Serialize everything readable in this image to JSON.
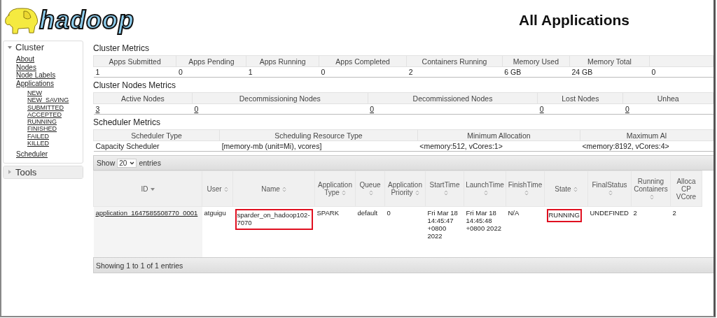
{
  "header": {
    "logo_text": "hadoop",
    "title": "All Applications"
  },
  "sidebar": {
    "sections": [
      {
        "label": "Cluster",
        "expanded": true,
        "items": [
          {
            "label": "About"
          },
          {
            "label": "Nodes"
          },
          {
            "label": "Node Labels"
          },
          {
            "label": "Applications",
            "children": [
              {
                "label": "NEW"
              },
              {
                "label": "NEW_SAVING"
              },
              {
                "label": "SUBMITTED"
              },
              {
                "label": "ACCEPTED"
              },
              {
                "label": "RUNNING"
              },
              {
                "label": "FINISHED"
              },
              {
                "label": "FAILED"
              },
              {
                "label": "KILLED"
              }
            ]
          },
          {
            "label": "Scheduler"
          }
        ]
      },
      {
        "label": "Tools",
        "expanded": false
      }
    ]
  },
  "cluster_metrics": {
    "title": "Cluster Metrics",
    "columns": [
      "Apps Submitted",
      "Apps Pending",
      "Apps Running",
      "Apps Completed",
      "Containers Running",
      "Memory Used",
      "Memory Total"
    ],
    "values": [
      {
        "text": "1",
        "link": false
      },
      {
        "text": "0",
        "link": false
      },
      {
        "text": "1",
        "link": false
      },
      {
        "text": "0",
        "link": false
      },
      {
        "text": "2",
        "link": false
      },
      {
        "text": "6 GB",
        "link": false
      },
      {
        "text": "24 GB",
        "link": false
      },
      {
        "text": "0",
        "link": false
      }
    ]
  },
  "cluster_nodes_metrics": {
    "title": "Cluster Nodes Metrics",
    "columns": [
      "Active Nodes",
      "Decommissioning Nodes",
      "Decommissioned Nodes",
      "Lost Nodes",
      "Unhea"
    ],
    "values": [
      {
        "text": "3",
        "link": true
      },
      {
        "text": "0",
        "link": true
      },
      {
        "text": "0",
        "link": true
      },
      {
        "text": "0",
        "link": true
      },
      {
        "text": "0",
        "link": true
      }
    ]
  },
  "scheduler_metrics": {
    "title": "Scheduler Metrics",
    "columns": [
      "Scheduler Type",
      "Scheduling Resource Type",
      "Minimum Allocation",
      "Maximum Al"
    ],
    "values": [
      {
        "text": "Capacity Scheduler",
        "link": false
      },
      {
        "text": "[memory-mb (unit=Mi), vcores]",
        "link": false
      },
      {
        "text": "<memory:512, vCores:1>",
        "link": false
      },
      {
        "text": "<memory:8192, vCores:4>",
        "link": false
      }
    ]
  },
  "applications": {
    "length_menu": {
      "before": "Show",
      "value": "20",
      "after": "entries"
    },
    "columns": [
      {
        "label": "ID",
        "sorted": true
      },
      {
        "label": "User",
        "sorted": false
      },
      {
        "label": "Name",
        "sorted": false
      },
      {
        "label": "Application Type",
        "sorted": false
      },
      {
        "label": "Queue",
        "sorted": false
      },
      {
        "label": "Application Priority",
        "sorted": false
      },
      {
        "label": "StartTime",
        "sorted": false
      },
      {
        "label": "LaunchTime",
        "sorted": false
      },
      {
        "label": "FinishTime",
        "sorted": false
      },
      {
        "label": "State",
        "sorted": false
      },
      {
        "label": "FinalStatus",
        "sorted": false
      },
      {
        "label": "Running Containers",
        "sorted": false
      },
      {
        "label": "Alloca CP VCore"
      }
    ],
    "rows": [
      {
        "cells": [
          {
            "text": "application_1647585508770_0001",
            "link": true,
            "highlighted": false
          },
          {
            "text": "atguigu",
            "link": false,
            "highlighted": false
          },
          {
            "text": "sparder_on_hadoop102-7070",
            "link": false,
            "highlighted": true
          },
          {
            "text": "SPARK",
            "link": false,
            "highlighted": false
          },
          {
            "text": "default",
            "link": false,
            "highlighted": false
          },
          {
            "text": "0",
            "link": false,
            "highlighted": false
          },
          {
            "text": "Fri Mar 18 14:45:47 +0800 2022",
            "link": false,
            "highlighted": false
          },
          {
            "text": "Fri Mar 18 14:45:48 +0800 2022",
            "link": false,
            "highlighted": false
          },
          {
            "text": "N/A",
            "link": false,
            "highlighted": false
          },
          {
            "text": "RUNNING",
            "link": false,
            "highlighted": true
          },
          {
            "text": "UNDEFINED",
            "link": false,
            "highlighted": false
          },
          {
            "text": "2",
            "link": false,
            "highlighted": false
          },
          {
            "text": "2",
            "link": false,
            "highlighted": false
          }
        ]
      }
    ],
    "info": "Showing 1 to 1 of 1 entries"
  }
}
